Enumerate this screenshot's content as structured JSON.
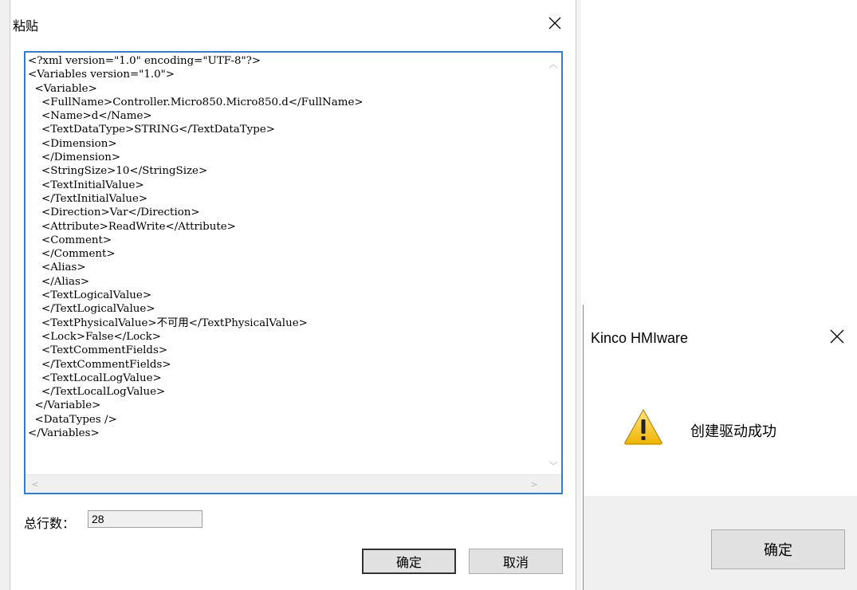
{
  "paste_dialog": {
    "title": "粘贴",
    "xml_content": "<?xml version=\"1.0\" encoding=\"UTF-8\"?>\n<Variables version=\"1.0\">\n  <Variable>\n    <FullName>Controller.Micro850.Micro850.d</FullName>\n    <Name>d</Name>\n    <TextDataType>STRING</TextDataType>\n    <Dimension>\n    </Dimension>\n    <StringSize>10</StringSize>\n    <TextInitialValue>\n    </TextInitialValue>\n    <Direction>Var</Direction>\n    <Attribute>ReadWrite</Attribute>\n    <Comment>\n    </Comment>\n    <Alias>\n    </Alias>\n    <TextLogicalValue>\n    </TextLogicalValue>\n    <TextPhysicalValue>不可用</TextPhysicalValue>\n    <Lock>False</Lock>\n    <TextCommentFields>\n    </TextCommentFields>\n    <TextLocalLogValue>\n    </TextLocalLogValue>\n  </Variable>\n  <DataTypes />\n</Variables>",
    "line_count_label": "总行数：",
    "line_count_value": "28",
    "ok_label": "确定",
    "cancel_label": "取消"
  },
  "message_box": {
    "title": "Kinco HMIware",
    "message": "创建驱动成功",
    "ok_label": "确定",
    "icon": "warning-icon"
  },
  "colors": {
    "focus_border": "#2f7fd8",
    "button_face": "#e1e1e1",
    "footer_bg": "#f0f0f0"
  }
}
